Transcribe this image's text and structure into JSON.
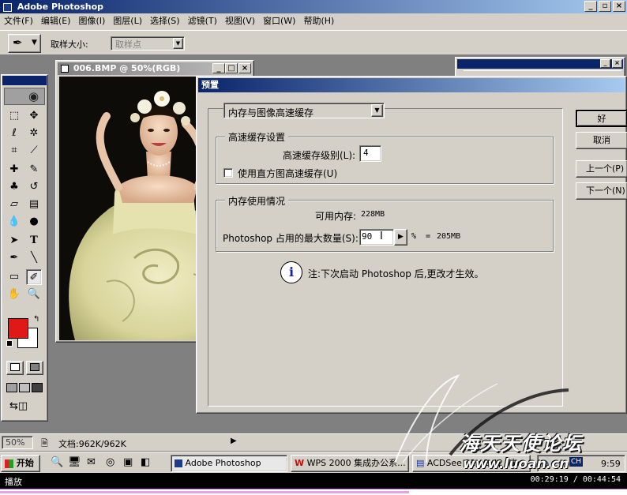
{
  "app": {
    "title": "Adobe Photoshop"
  },
  "menu": [
    "文件(F)",
    "编辑(E)",
    "图像(I)",
    "图层(L)",
    "选择(S)",
    "滤镜(T)",
    "视图(V)",
    "窗口(W)",
    "帮助(H)"
  ],
  "options_bar": {
    "label": "取样大小:",
    "select_value": "取样点"
  },
  "doc_window": {
    "title": "006.BMP @ 50%(RGB)"
  },
  "dialog": {
    "title": "预置",
    "dropdown_value": "内存与图像高速缓存",
    "cache_group": {
      "title": "高速缓存设置",
      "level_label": "高速缓存级别(L):",
      "level_value": "4",
      "histogram_label": "使用直方图高速缓存(U)"
    },
    "memory_group": {
      "title": "内存使用情况",
      "available_label": "可用内存:",
      "available_value": "228MB",
      "max_label": "Photoshop 占用的最大数量(S):",
      "max_value": "90",
      "percent_sign": "%",
      "equals": "=",
      "result": "205MB"
    },
    "note": "注:下次启动 Photoshop 后,更改才生效。",
    "buttons": {
      "ok": "好",
      "cancel": "取消",
      "prev": "上一个(P)",
      "next": "下一个(N)"
    }
  },
  "status_bar": {
    "zoom": "50%",
    "doc_info": "文档:962K/962K"
  },
  "taskbar": {
    "start": "开始",
    "items": [
      "Adobe Photoshop",
      "WPS 2000 集成办公系...",
      "ACDSee 32 v2.42 [未..."
    ],
    "ime": "CH",
    "clock": "9:59"
  },
  "player": {
    "label": "播放",
    "time": "00:29:19 / 00:44:54"
  },
  "watermark": {
    "text": "海天天使论坛",
    "url": "www.luoan.cn"
  },
  "colors": {
    "foreground": "#e01818",
    "background": "#ffffff",
    "title_active": "#0a246a",
    "title_inactive": "#808080"
  }
}
